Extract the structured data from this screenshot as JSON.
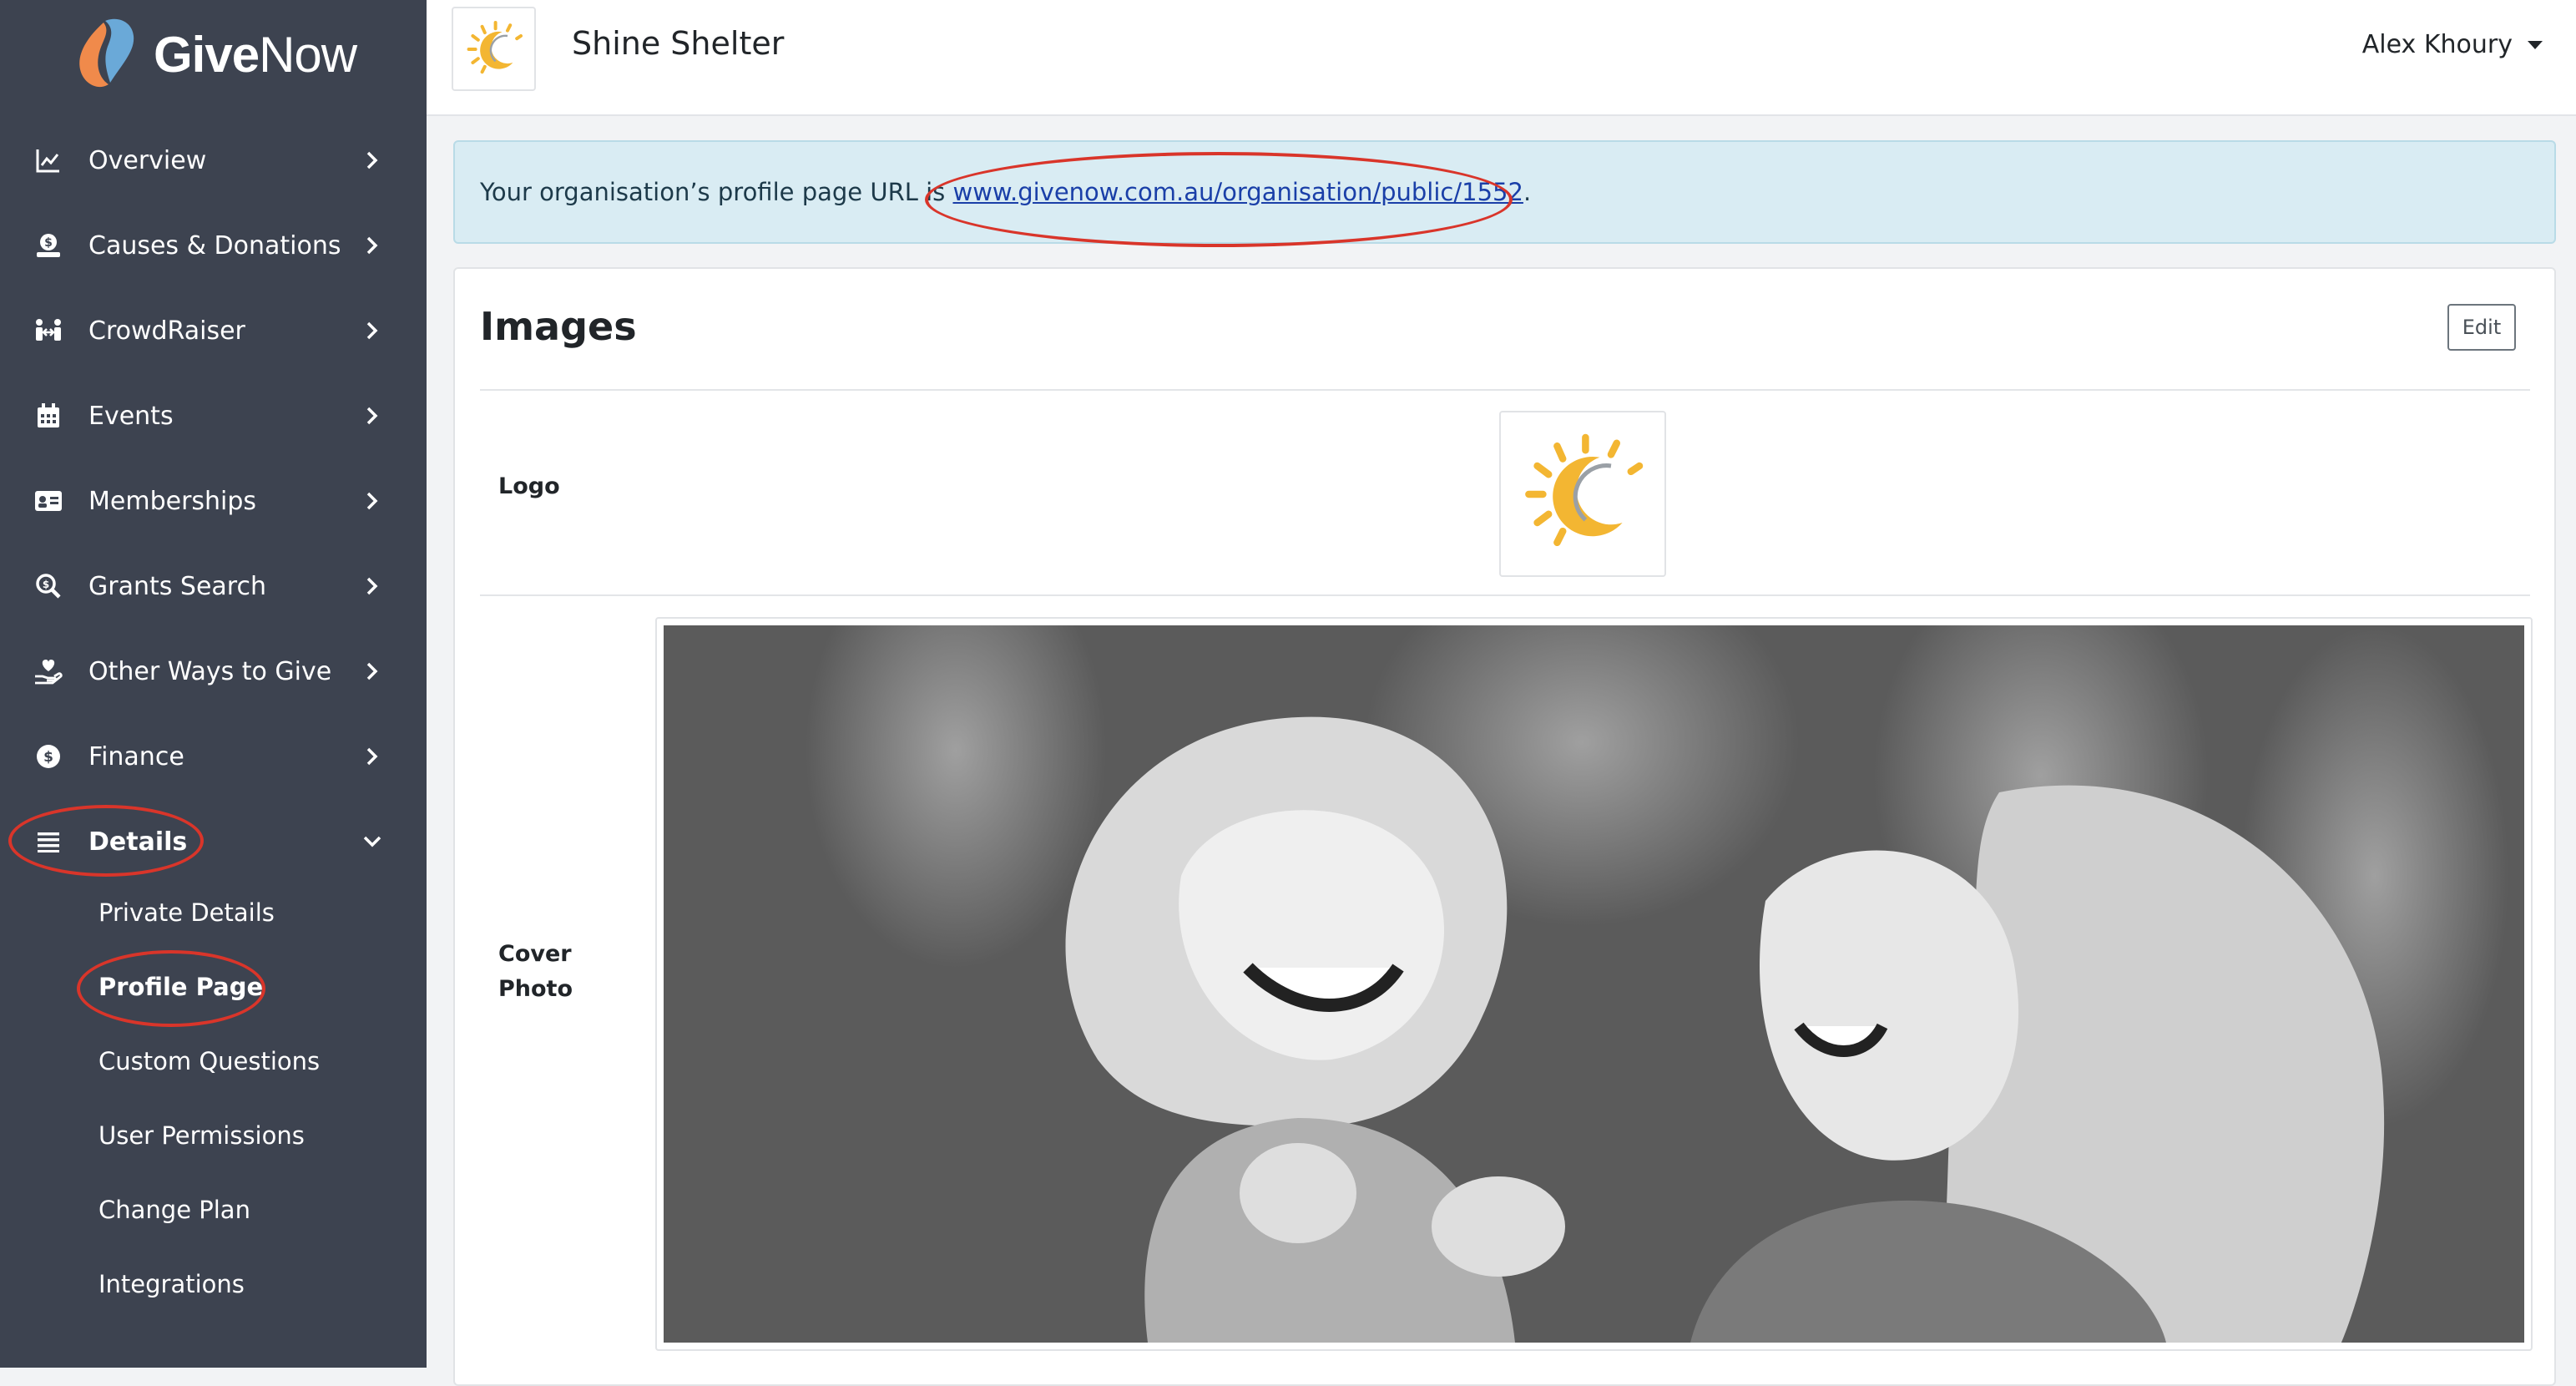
{
  "brand": {
    "name_bold": "Give",
    "name_regular": "Now"
  },
  "colors": {
    "sidebar": "#3d4350",
    "annotation_ring": "#d9352a",
    "alert_bg": "#d9ecf3",
    "link": "#1a3fa8",
    "brand_orange": "#f08a4b",
    "brand_blue": "#6aa9d8",
    "sun_yellow": "#f3b632"
  },
  "sidebar": {
    "items": [
      {
        "label": "Overview",
        "icon": "chart-line-icon"
      },
      {
        "label": "Causes & Donations",
        "icon": "dollar-hand-icon"
      },
      {
        "label": "CrowdRaiser",
        "icon": "people-arrows-icon"
      },
      {
        "label": "Events",
        "icon": "calendar-icon"
      },
      {
        "label": "Memberships",
        "icon": "id-card-icon"
      },
      {
        "label": "Grants Search",
        "icon": "search-dollar-icon"
      },
      {
        "label": "Other Ways to Give",
        "icon": "hand-heart-icon"
      },
      {
        "label": "Finance",
        "icon": "coin-icon"
      },
      {
        "label": "Details",
        "icon": "list-icon",
        "expanded": true
      }
    ],
    "details_submenu": [
      {
        "label": "Private Details"
      },
      {
        "label": "Profile Page",
        "active": true
      },
      {
        "label": "Custom Questions"
      },
      {
        "label": "User Permissions"
      },
      {
        "label": "Change Plan"
      },
      {
        "label": "Integrations"
      }
    ]
  },
  "header": {
    "org_name": "Shine Shelter",
    "user_name": "Alex Khoury"
  },
  "alert": {
    "prefix": "Your organisation’s profile page URL is ",
    "url_text": "www.givenow.com.au/organisation/public/1552",
    "suffix": "."
  },
  "images_card": {
    "title": "Images",
    "edit_label": "Edit",
    "logo_label": "Logo",
    "cover_label_line1": "Cover",
    "cover_label_line2": "Photo"
  }
}
